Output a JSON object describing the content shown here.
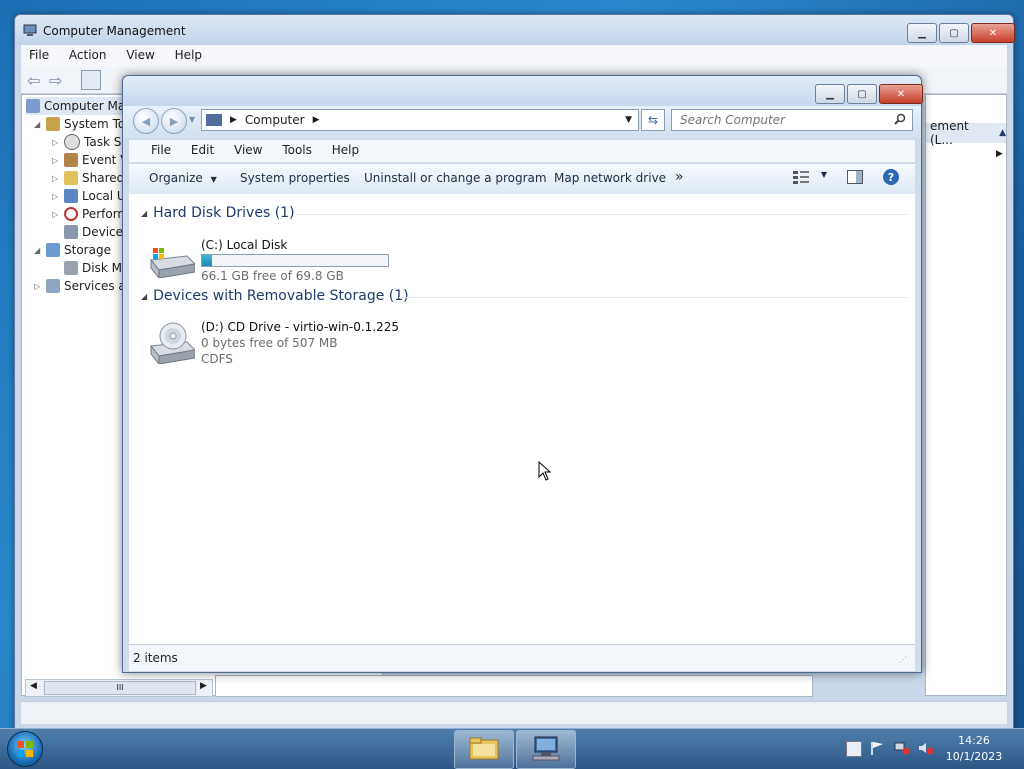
{
  "computer_management": {
    "title": "Computer Management",
    "menu": [
      "File",
      "Action",
      "View",
      "Help"
    ],
    "tree": [
      {
        "label": "Computer Ma",
        "level": 0
      },
      {
        "label": "System To",
        "level": 1
      },
      {
        "label": "Task Sc",
        "level": 2
      },
      {
        "label": "Event V",
        "level": 2
      },
      {
        "label": "Shared",
        "level": 2
      },
      {
        "label": "Local U",
        "level": 2
      },
      {
        "label": "Perform",
        "level": 2
      },
      {
        "label": "Device",
        "level": 2
      },
      {
        "label": "Storage",
        "level": 1
      },
      {
        "label": "Disk M",
        "level": 2
      },
      {
        "label": "Services an",
        "level": 1
      }
    ],
    "actions_header": "ement (L...",
    "scroll_label": "III"
  },
  "explorer": {
    "breadcrumb": "Computer",
    "search_placeholder": "Search Computer",
    "menu": [
      "File",
      "Edit",
      "View",
      "Tools",
      "Help"
    ],
    "commands": {
      "organize": "Organize",
      "system_properties": "System properties",
      "uninstall": "Uninstall or change a program",
      "map_drive": "Map network drive",
      "more": "»"
    },
    "groups": {
      "hdd": {
        "title": "Hard Disk Drives (1)",
        "drive": {
          "name": "(C:) Local Disk",
          "free": "66.1 GB free of 69.8 GB",
          "used_fraction": 0.053
        }
      },
      "removable": {
        "title": "Devices with Removable Storage (1)",
        "drive": {
          "name": "(D:) CD Drive - virtio-win-0.1.225",
          "free": "0 bytes free of 507 MB",
          "fs": "CDFS"
        }
      }
    },
    "status": "2 items"
  },
  "taskbar": {
    "time": "14:26",
    "date": "10/1/2023"
  },
  "colors": {
    "accent": "#1f86b5",
    "group_header": "#1e3a6e",
    "desktop": "#1d6fb3"
  }
}
